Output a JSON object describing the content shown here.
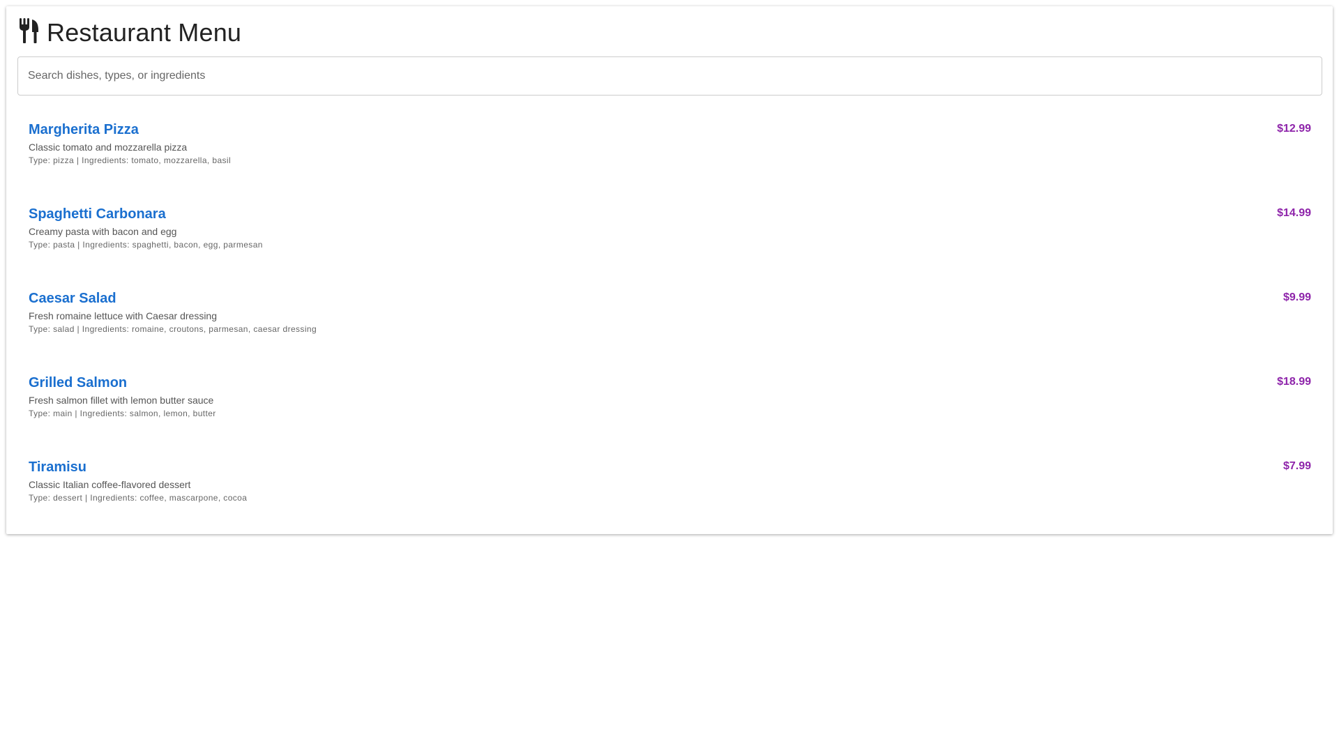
{
  "header": {
    "icon": "utensils-icon",
    "title": "Restaurant Menu"
  },
  "search": {
    "placeholder": "Search dishes, types, or ingredients",
    "value": ""
  },
  "colors": {
    "item_name": "#1a6fcf",
    "price": "#8e24aa"
  },
  "menu": {
    "items": [
      {
        "name": "Margherita Pizza",
        "description": "Classic tomato and mozzarella pizza",
        "meta": "Type: pizza | Ingredients: tomato, mozzarella, basil",
        "price": "$12.99"
      },
      {
        "name": "Spaghetti Carbonara",
        "description": "Creamy pasta with bacon and egg",
        "meta": "Type: pasta | Ingredients: spaghetti, bacon, egg, parmesan",
        "price": "$14.99"
      },
      {
        "name": "Caesar Salad",
        "description": "Fresh romaine lettuce with Caesar dressing",
        "meta": "Type: salad | Ingredients: romaine, croutons, parmesan, caesar dressing",
        "price": "$9.99"
      },
      {
        "name": "Grilled Salmon",
        "description": "Fresh salmon fillet with lemon butter sauce",
        "meta": "Type: main | Ingredients: salmon, lemon, butter",
        "price": "$18.99"
      },
      {
        "name": "Tiramisu",
        "description": "Classic Italian coffee-flavored dessert",
        "meta": "Type: dessert | Ingredients: coffee, mascarpone, cocoa",
        "price": "$7.99"
      }
    ]
  }
}
